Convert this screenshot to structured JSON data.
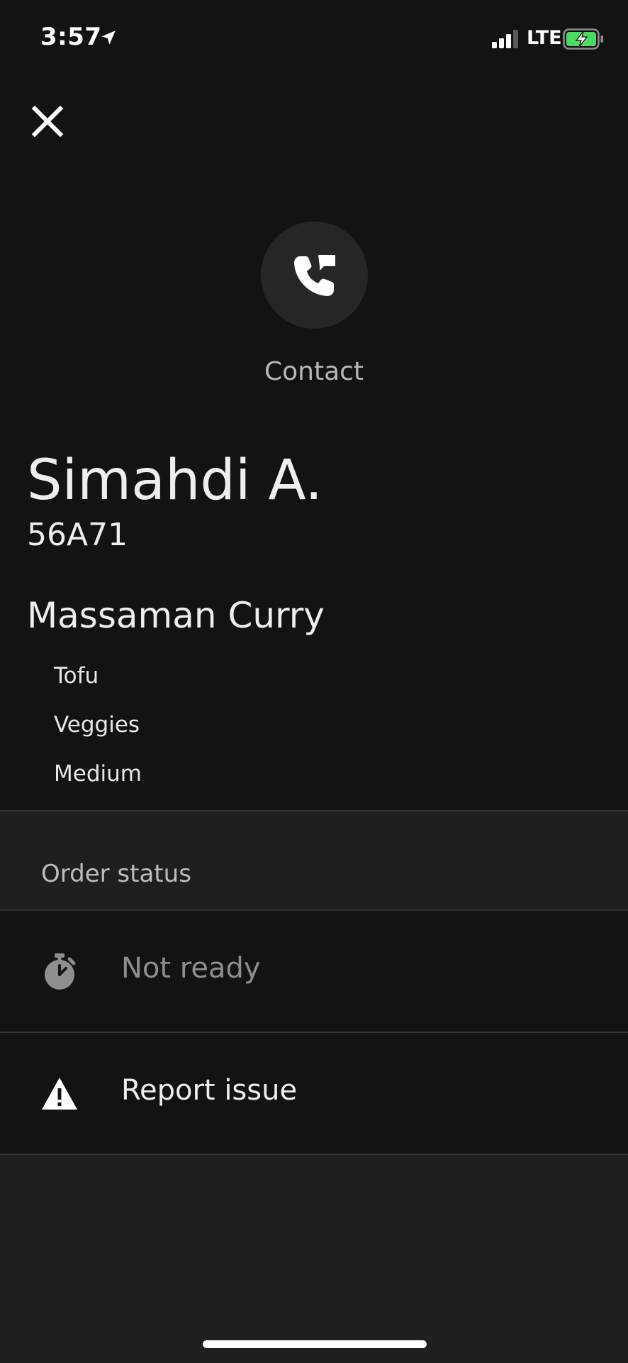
{
  "status_bar": {
    "time": "3:57",
    "network": "LTE",
    "icons": {
      "location": "location-arrow-icon",
      "signal": "cellular-signal-icon",
      "battery": "battery-charging-icon"
    },
    "battery_color": "#4cd964"
  },
  "header": {
    "close_icon": "close-icon"
  },
  "contact": {
    "label": "Contact",
    "icon": "phone-message-icon"
  },
  "order": {
    "customer_name": "Simahdi A.",
    "order_code": "56A71",
    "item_name": "Massaman Curry",
    "modifiers": [
      "Tofu",
      "Veggies",
      "Medium"
    ]
  },
  "order_status": {
    "section_title": "Order status",
    "status_label": "Not ready",
    "status_icon": "stopwatch-icon"
  },
  "actions": {
    "report_label": "Report issue",
    "report_icon": "warning-icon"
  },
  "colors": {
    "background": "#131314",
    "section_background": "#1f1f20",
    "contact_circle": "#262628",
    "divider": "#343436"
  }
}
